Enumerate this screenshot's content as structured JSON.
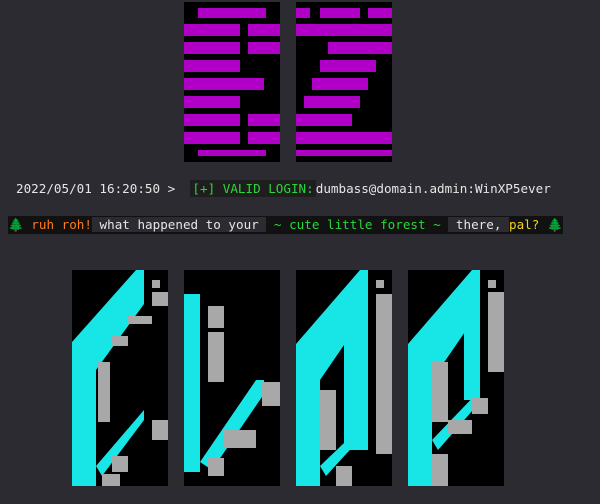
{
  "login": {
    "timestamp": "2022/05/01 16:20:50",
    "prompt": " > ",
    "status": "[+] VALID LOGIN:",
    "credentials": "dumbass@domain.admin:WinXP5ever"
  },
  "forest_message": {
    "tree_left": "🌲",
    "ruh_roh": "ruh roh!",
    "middle": " what happened to your ",
    "forest": " ~ cute little forest ~ ",
    "there": " there, ",
    "pal": "pal?",
    "tree_right": "🌲"
  },
  "colors": {
    "background": "#2b2b31",
    "magenta": "#b000c8",
    "cyan": "#18e6e6",
    "gray": "#a8a8a8",
    "green": "#2bd63c",
    "orange": "#ff7a1a",
    "yellow": "#f2d21a"
  }
}
